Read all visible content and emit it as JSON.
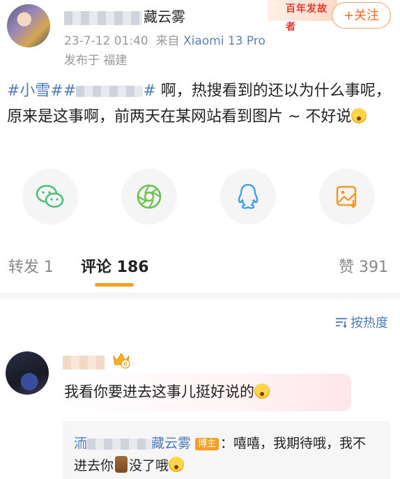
{
  "header": {
    "author_suffix": "藏云雾",
    "banner_text": "百年发故者",
    "follow_label": "+关注",
    "date": "23-7-12 01:40",
    "source_prefix": "来自",
    "device": "Xiaomi 13 Pro",
    "location": "发布于 福建"
  },
  "post": {
    "tag1": "#小雪#",
    "tag2_prefix": "#",
    "tag2_suffix": "#",
    "body": " 啊，热搜看到的还以为什么事呢，原来是这事啊，前两天在某网站看到图片 ~ 不好说"
  },
  "share": [
    {
      "icon": "wechat-icon"
    },
    {
      "icon": "moments-icon"
    },
    {
      "icon": "qq-icon"
    },
    {
      "icon": "save-image-icon"
    }
  ],
  "tabs": {
    "repost": "转发 1",
    "comments": "评论 186",
    "likes": "赞 391"
  },
  "sort_label": "按热度",
  "comment": {
    "crown_level": "6",
    "text": "我看你要进去这事儿挺好说的",
    "reply": {
      "name_prefix": "洏",
      "name_suffix": "藏云雾",
      "badge": "博主",
      "text_a": "：嘻嘻，我期待哦，我不进去你",
      "text_b": "没了哦"
    }
  },
  "colors": {
    "link": "#4f7bb6",
    "accent": "#f7a21e",
    "follow": "#f06b25"
  }
}
